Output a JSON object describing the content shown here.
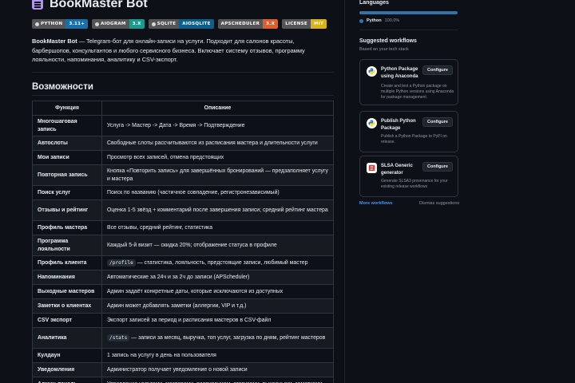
{
  "readme": {
    "title": "BookMaster Bot",
    "badges": [
      {
        "left": "PYTHON",
        "right": "3.11+",
        "color": "#1b6fa8"
      },
      {
        "left": "AIOGRAM",
        "right": "3.X",
        "color": "#1a9a8e"
      },
      {
        "left": "SQLITE",
        "right": "AIOSQLITE",
        "color": "#0b5f8a"
      },
      {
        "left": "APSCHEDULER",
        "right": "3.X",
        "color": "#e05d2c"
      },
      {
        "left": "LICENSE",
        "right": "MIT",
        "color": "#d8b31c"
      }
    ],
    "intro_bold": "BookMaster Bot",
    "intro_text": " — Telegram-бот для онлайн-записи на услуги. Подходит для салонов красоты, барбершопов, консультантов и любого сервисного бизнеса. Включает систему отзывов, программу лояльности, напоминания, аналитику и CSV-экспорт.",
    "section_title": "Возможности",
    "table": {
      "headers": [
        "Функция",
        "Описание"
      ],
      "rows": [
        {
          "name": "Многошаговая запись",
          "desc": "Услуга -> Мастер -> Дата -> Время -> Подтверждение"
        },
        {
          "name": "Автослоты",
          "desc": "Свободные слоты рассчитываются из расписания мастера и длительности услуги"
        },
        {
          "name": "Мои записи",
          "desc": "Просмотр всех записей, отмена предстоящих"
        },
        {
          "name": "Повторная запись",
          "desc": "Кнопка «Повторить запись» для завершённых бронирований — предзаполняет услугу и мастера"
        },
        {
          "name": "Поиск услуг",
          "desc": "Поиск по названию (частичное совпадение, регистронезависимый)"
        },
        {
          "name": "Отзывы и рейтинг",
          "desc": "Оценка 1-5 звёзд + комментарий после завершения записи; средний рейтинг мастера"
        },
        {
          "name": "Профиль мастера",
          "desc": "Все отзывы, средний рейтинг, статистика"
        },
        {
          "name": "Программа лояльности",
          "desc": "Каждый 5-й визит — скидка 20%; отображение статуса в профиле"
        },
        {
          "name": "Профиль клиента",
          "code": "/profile",
          "desc": " — статистика, лояльность, предстоящие записи, любимый мастер"
        },
        {
          "name": "Напоминания",
          "desc": "Автоматические за 24ч и за 2ч до записи (APScheduler)"
        },
        {
          "name": "Выходные мастеров",
          "desc": "Админ задаёт конкретные даты, которые исключаются из доступных"
        },
        {
          "name": "Заметки о клиентах",
          "desc": "Админ может добавлять заметки (аллергии, VIP и т.д.)"
        },
        {
          "name": "CSV экспорт",
          "desc": "Экспорт записей за период и расписания мастеров в CSV-файл"
        },
        {
          "name": "Аналитика",
          "code": "/stats",
          "desc": " — записи за месяц, выручка, топ услуг, загрузка по дням, рейтинг мастеров"
        },
        {
          "name": "Кулдаун",
          "desc": "1 запись на услугу в день на пользователя"
        },
        {
          "name": "Уведомления",
          "desc": "Администратор получает уведомление о новой записи"
        },
        {
          "name": "Админ-панель",
          "desc": "Управление услугами, мастерами, расписанием, статусами, выходными, заметками"
        }
      ]
    }
  },
  "sidebar": {
    "languages_title": "Languages",
    "language": {
      "name": "Python",
      "percent": "100.0%",
      "color": "#3572a5"
    },
    "suggested_title": "Suggested workflows",
    "suggested_sub": "Based on your tech stack",
    "configure_label": "Configure",
    "workflows": [
      {
        "title": "Python Package using Anaconda",
        "desc": "Create and test a Python package on multiple Python versions using Anaconda for package management.",
        "icon": "python-icon"
      },
      {
        "title": "Publish Python Package",
        "desc": "Publish a Python Package to PyPI on release.",
        "icon": "python-icon"
      },
      {
        "title": "SLSA Generic generator",
        "desc": "Generate SLSA3 provenance for your existing release workflows",
        "icon": "slsa-icon"
      }
    ],
    "more_workflows": "More workflows",
    "dismiss": "Dismiss suggestions"
  }
}
